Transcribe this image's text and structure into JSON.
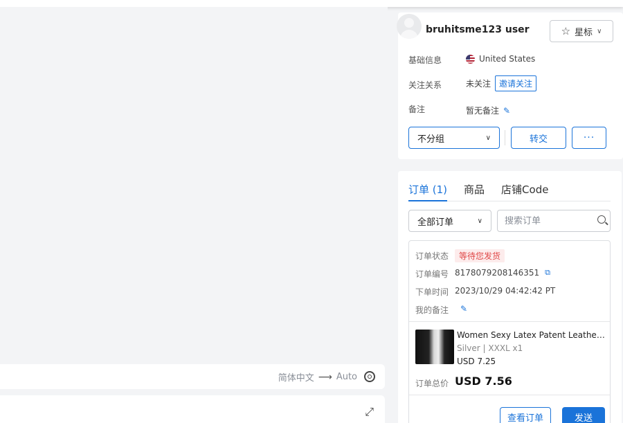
{
  "user": {
    "name": "bruhitsme123 user",
    "star_label": "星标",
    "basic_info_label": "基础信息",
    "country": "United States",
    "follow_label": "关注关系",
    "follow_status": "未关注",
    "invite_label": "邀请关注",
    "note_label": "备注",
    "note_value": "暂无备注",
    "group_select": "不分组",
    "transfer_label": "转交",
    "more_label": "···"
  },
  "orders": {
    "tabs": [
      {
        "label": "订单 (1)",
        "active": true
      },
      {
        "label": "商品",
        "active": false
      },
      {
        "label": "店铺Code",
        "active": false
      }
    ],
    "filter_select": "全部订单",
    "search_placeholder": "搜索订单",
    "order": {
      "status_label": "订单状态",
      "status_value": "等待您发货",
      "number_label": "订单编号",
      "number_value": "8178079208146351",
      "time_label": "下单时间",
      "time_value": "2023/10/29 04:42:42 PT",
      "my_note_label": "我的备注",
      "product_title": "Women Sexy Latex Patent Leather T...",
      "product_variant": "Silver | XXXL x1",
      "product_price": "USD 7.25",
      "total_label": "订单总价",
      "total_value": "USD 7.56",
      "view_button": "查看订单",
      "send_button": "发送"
    }
  },
  "translate": {
    "source": "简体中文",
    "arrow": "⟶",
    "target": "Auto"
  },
  "colors": {
    "accent": "#1a73d9",
    "status_red": "#e04848",
    "status_bg": "#fdecec"
  }
}
